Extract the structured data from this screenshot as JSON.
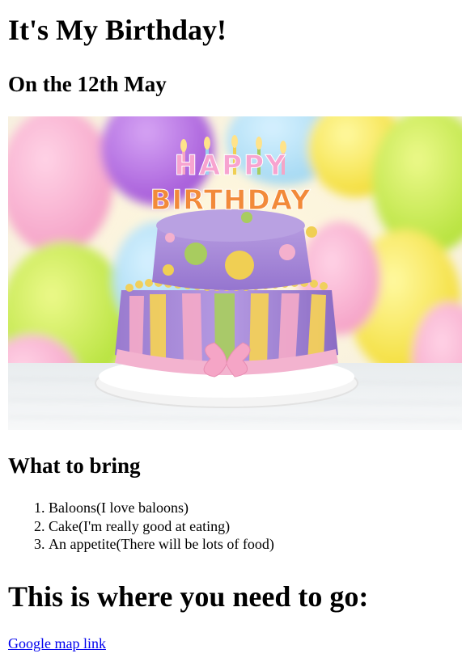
{
  "page": {
    "title": "It's My Birthday!",
    "date": "On the 12th May"
  },
  "image": {
    "cake_text_line1": "HAPPY",
    "cake_text_line2": "BIRTHDAY"
  },
  "bring": {
    "heading": "What to bring",
    "items": [
      "Baloons(I love baloons)",
      "Cake(I'm really good at eating)",
      "An appetite(There will be lots of food)"
    ]
  },
  "directions": {
    "heading": "This is where you need to go:",
    "link_text": "Google map link"
  },
  "colors": {
    "link": "#0000ee",
    "cake_purple": "#9b82c9",
    "cake_pink": "#f0a7c6",
    "cake_yellow": "#f2cf4f",
    "cake_green": "#a6c95c"
  }
}
